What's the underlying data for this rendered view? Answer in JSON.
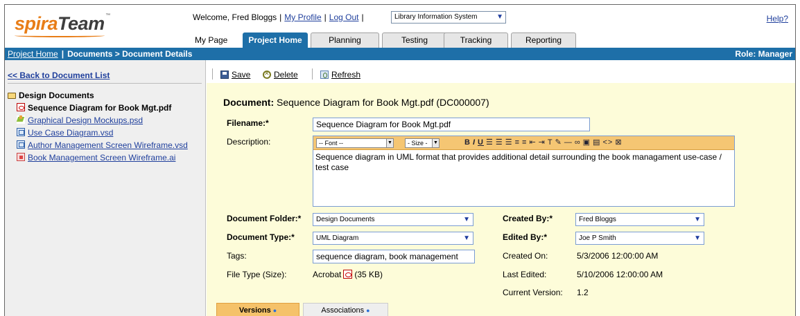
{
  "app": {
    "logo_primary": "spira",
    "logo_secondary": "Team",
    "logo_tm": "™"
  },
  "header": {
    "welcome": "Welcome, Fred Bloggs",
    "my_profile": "My Profile",
    "log_out": "Log Out",
    "project_selected": "Library Information System",
    "help": "Help?",
    "my_page": "My Page",
    "tabs": [
      {
        "label": "Project Home",
        "active": true
      },
      {
        "label": "Planning",
        "active": false
      },
      {
        "label": "Testing",
        "active": false
      },
      {
        "label": "Tracking",
        "active": false
      },
      {
        "label": "Reporting",
        "active": false
      }
    ]
  },
  "breadcrumb": {
    "home": "Project Home",
    "separator": "|",
    "current": "Documents > Document Details",
    "role": "Role: Manager"
  },
  "sidebar": {
    "back_link": "<< Back to Document List",
    "folder": "Design Documents",
    "items": [
      {
        "label": "Sequence Diagram for Book Mgt.pdf",
        "icon": "pdf-icon",
        "current": true
      },
      {
        "label": "Graphical Design Mockups.psd",
        "icon": "psd-icon",
        "current": false
      },
      {
        "label": "Use Case Diagram.vsd",
        "icon": "vsd-icon",
        "current": false
      },
      {
        "label": "Author Management Screen Wireframe.vsd",
        "icon": "vsd-icon",
        "current": false
      },
      {
        "label": "Book Management Screen Wireframe.ai",
        "icon": "ai-icon",
        "current": false
      }
    ]
  },
  "toolbar": {
    "save": "Save",
    "delete": "Delete",
    "refresh": "Refresh"
  },
  "document": {
    "title_label": "Document:",
    "title_value": "Sequence Diagram for Book Mgt.pdf (DC000007)",
    "filename_label": "Filename:*",
    "filename_value": "Sequence Diagram for Book Mgt.pdf",
    "description_label": "Description:",
    "description_value": "Sequence diagram in UML format that provides additional detail surrounding the book managament use-case / test case",
    "editor_font": "-- Font --",
    "editor_size": "- Size -",
    "folder_label": "Document Folder:*",
    "folder_value": "Design Documents",
    "type_label": "Document Type:*",
    "type_value": "UML Diagram",
    "tags_label": "Tags:",
    "tags_value": "sequence diagram, book management",
    "filetype_label": "File Type (Size):",
    "filetype_name": "Acrobat",
    "filetype_size": "(35 KB)",
    "created_by_label": "Created By:*",
    "created_by_value": "Fred Bloggs",
    "edited_by_label": "Edited By:*",
    "edited_by_value": "Joe P Smith",
    "created_on_label": "Created On:",
    "created_on_value": "5/3/2006 12:00:00 AM",
    "last_edited_label": "Last Edited:",
    "last_edited_value": "5/10/2006 12:00:00 AM",
    "version_label": "Current Version:",
    "version_value": "1.2"
  },
  "bottom_tabs": [
    {
      "label": "Versions",
      "active": true
    },
    {
      "label": "Associations",
      "active": false
    }
  ],
  "colors": {
    "brand_orange": "#e87d17",
    "nav_blue": "#1e6fa8",
    "link_blue": "#1f3f9c",
    "form_bg": "#fdfcd9",
    "editor_bar": "#f5c673"
  }
}
